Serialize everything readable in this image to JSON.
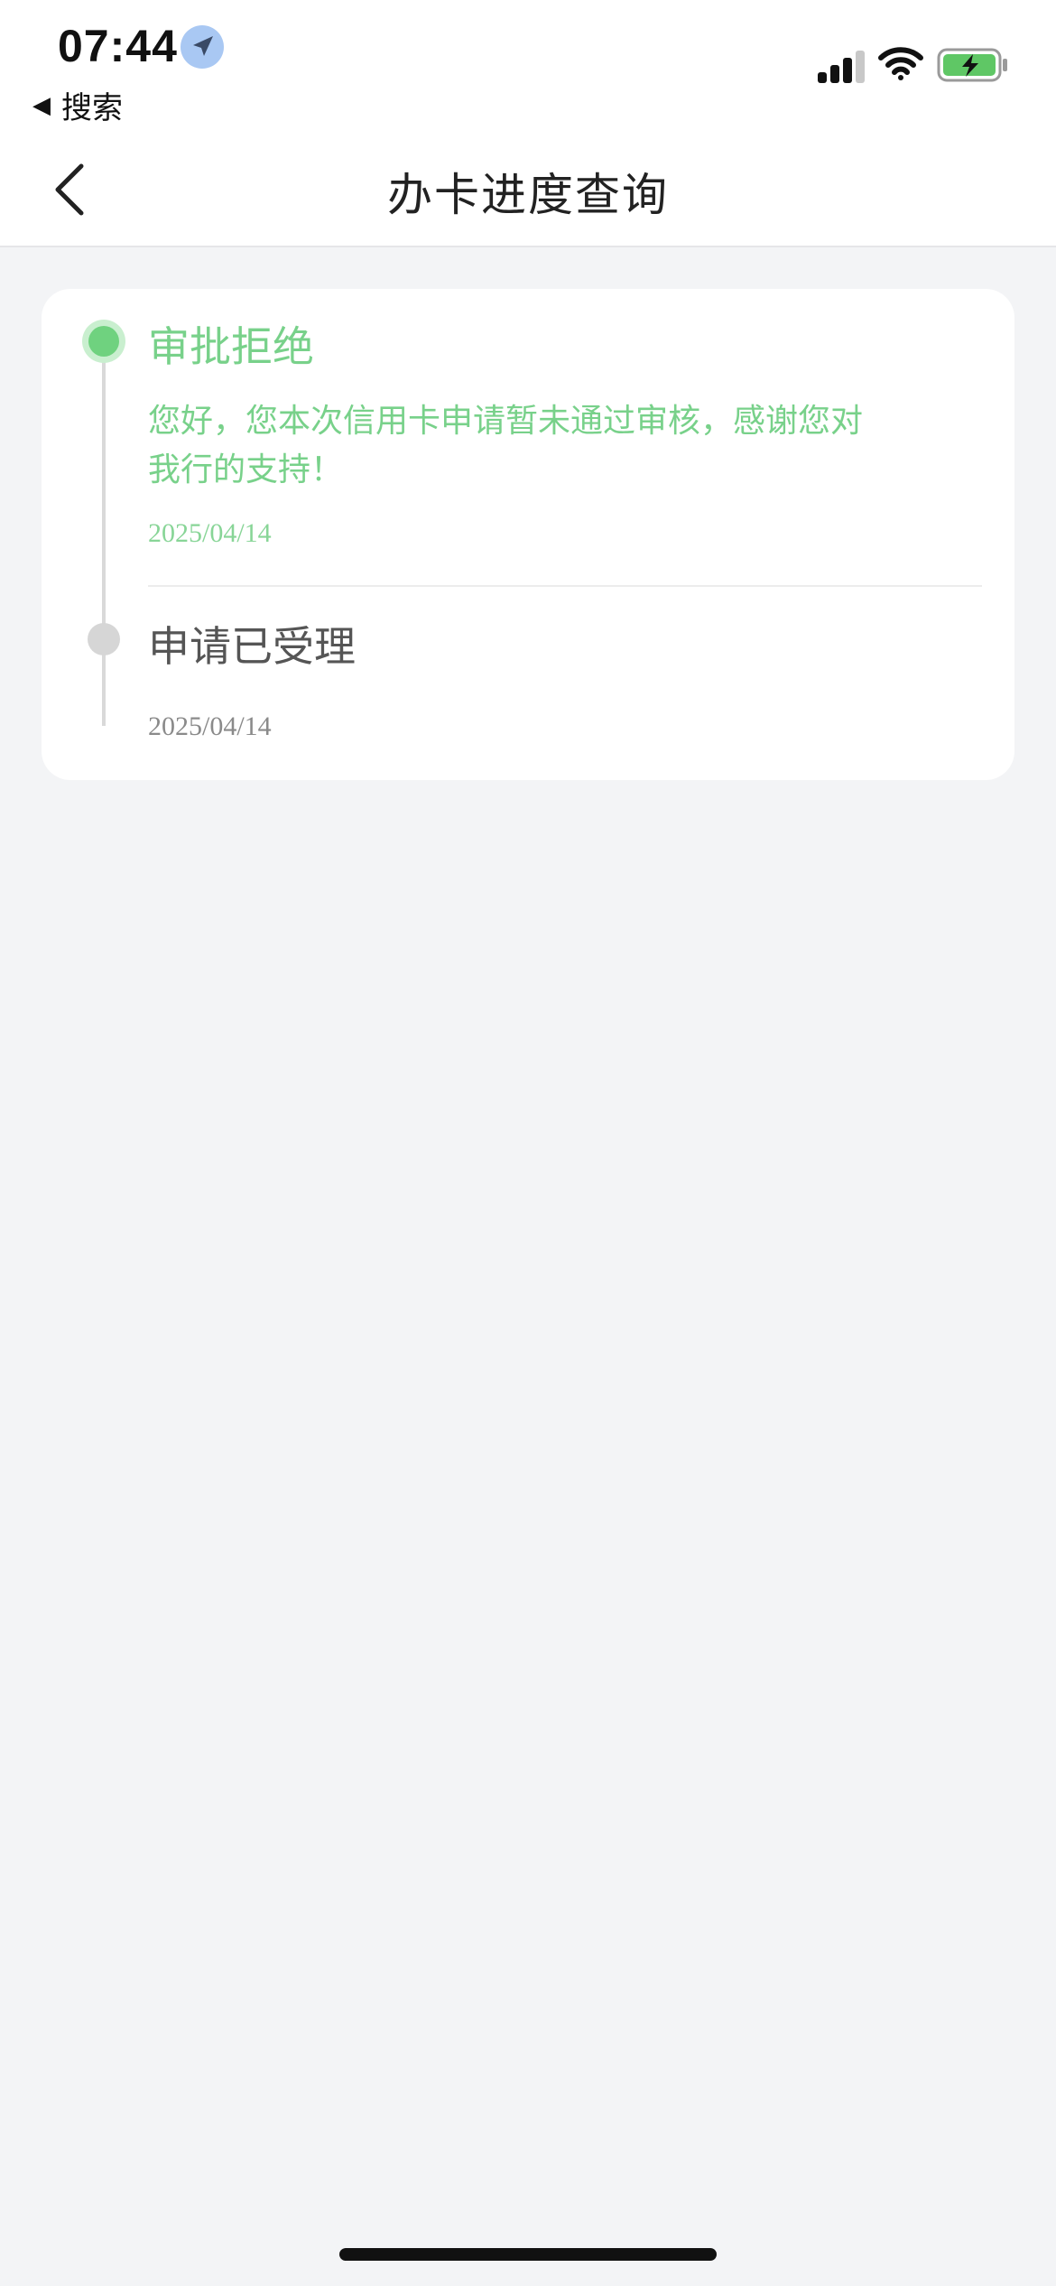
{
  "status_bar": {
    "time": "07:44",
    "back_app_label": "搜索",
    "back_triangle": "◀"
  },
  "nav": {
    "title": "办卡进度查询"
  },
  "progress": {
    "steps": [
      {
        "title": "审批拒绝",
        "description": "您好，您本次信用卡申请暂未通过审核，感谢您对我行的支持！",
        "date": "2025/04/14",
        "state": "active"
      },
      {
        "title": "申请已受理",
        "description": "",
        "date": "2025/04/14",
        "state": "done"
      }
    ]
  },
  "colors": {
    "accent_green": "#6fd27f",
    "text_green": "#78d18a",
    "background": "#f3f4f6"
  },
  "icons": {
    "location": "location-arrow-icon",
    "signal": "cellular-signal-icon",
    "wifi": "wifi-icon",
    "battery": "battery-charging-icon",
    "back": "chevron-left-icon"
  }
}
